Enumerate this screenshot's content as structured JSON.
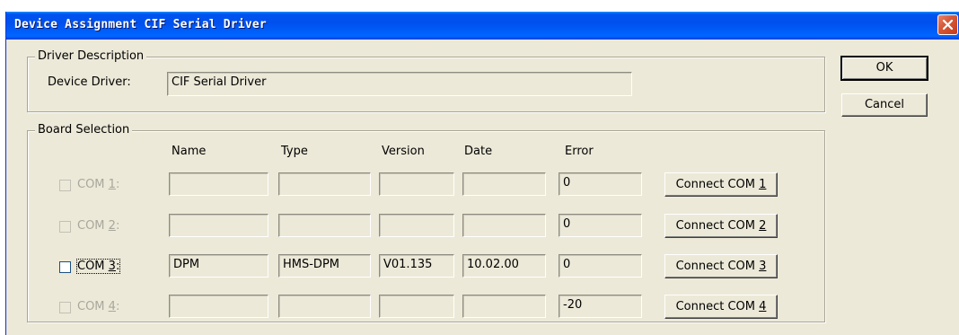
{
  "dialog": {
    "title": "Device Assignment CIF Serial Driver",
    "ok_label": "OK",
    "cancel_label": "Cancel"
  },
  "driver_description": {
    "legend": "Driver Description",
    "device_driver_label": "Device Driver:",
    "device_driver_value": "CIF Serial Driver"
  },
  "board_selection": {
    "legend": "Board Selection",
    "headers": {
      "name": "Name",
      "type": "Type",
      "version": "Version",
      "date": "Date",
      "error": "Error"
    },
    "rows": [
      {
        "label_prefix": "COM ",
        "label_key": "1",
        "label_suffix": ":",
        "checked": false,
        "enabled": false,
        "name": "",
        "type": "",
        "version": "",
        "date": "",
        "error": "0",
        "button_prefix": "Connect COM ",
        "button_key": "1"
      },
      {
        "label_prefix": "COM ",
        "label_key": "2",
        "label_suffix": ":",
        "checked": false,
        "enabled": false,
        "name": "",
        "type": "",
        "version": "",
        "date": "",
        "error": "0",
        "button_prefix": "Connect COM ",
        "button_key": "2"
      },
      {
        "label_prefix": "COM ",
        "label_key": "3",
        "label_suffix": ":",
        "checked": false,
        "enabled": true,
        "name": "DPM",
        "type": "HMS-DPM",
        "version": "V01.135",
        "date": "10.02.00",
        "error": "0",
        "button_prefix": "Connect COM ",
        "button_key": "3"
      },
      {
        "label_prefix": "COM ",
        "label_key": "4",
        "label_suffix": ":",
        "checked": false,
        "enabled": false,
        "name": "",
        "type": "",
        "version": "",
        "date": "",
        "error": "-20",
        "button_prefix": "Connect COM ",
        "button_key": "4"
      }
    ]
  }
}
